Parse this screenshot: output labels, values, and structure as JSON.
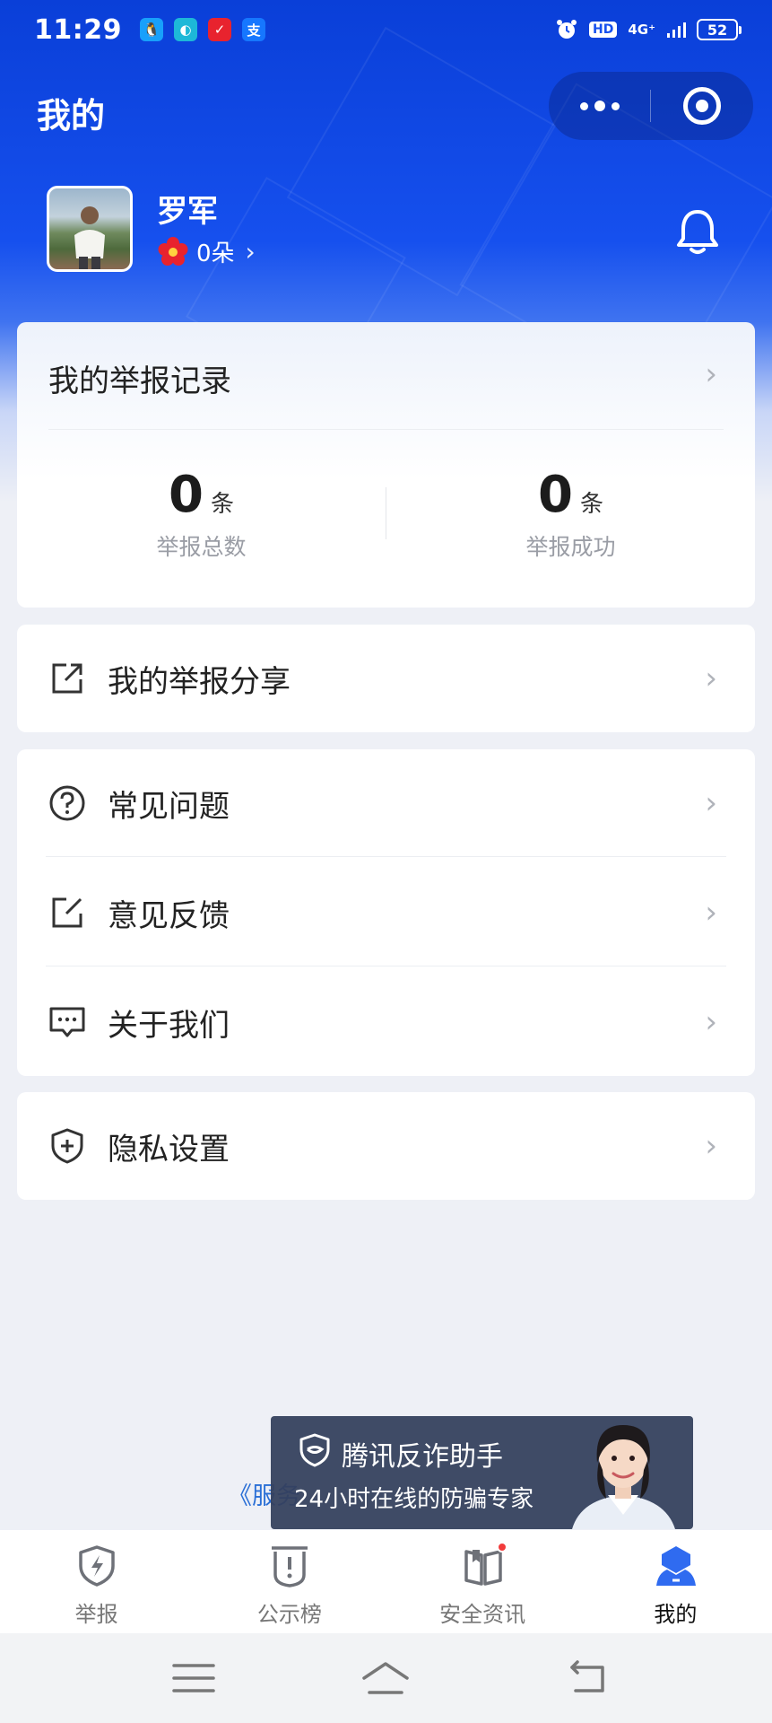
{
  "status_bar": {
    "time": "11:29",
    "network": "4G⁺",
    "hd": "HD",
    "battery": "52",
    "apps": [
      {
        "icon": "qq-icon",
        "glyph": "🐧",
        "color": "#18a0fb"
      },
      {
        "icon": "browser-icon",
        "glyph": "◐",
        "color": "#1db8d8"
      },
      {
        "icon": "news-icon",
        "glyph": "✓",
        "color": "#e8232e"
      },
      {
        "icon": "alipay-icon",
        "glyph": "支",
        "color": "#1677ff"
      }
    ]
  },
  "header": {
    "title": "我的"
  },
  "profile": {
    "name": "罗军",
    "flower_count": "0朵",
    "flower_chevron": "›"
  },
  "record": {
    "title": "我的举报记录",
    "stats": [
      {
        "value": "0",
        "unit": "条",
        "label": "举报总数"
      },
      {
        "value": "0",
        "unit": "条",
        "label": "举报成功"
      }
    ]
  },
  "menu_groups": [
    {
      "items": [
        {
          "label": "我的举报分享",
          "icon": "share-icon"
        }
      ]
    },
    {
      "items": [
        {
          "label": "常见问题",
          "icon": "question-icon"
        },
        {
          "label": "意见反馈",
          "icon": "feedback-icon"
        },
        {
          "label": "关于我们",
          "icon": "about-icon"
        }
      ]
    },
    {
      "items": [
        {
          "label": "隐私设置",
          "icon": "privacy-shield-icon"
        }
      ]
    }
  ],
  "chevron": "›",
  "service_link": "《服务",
  "assistant_tooltip": {
    "title": "腾讯反诈助手",
    "subtitle": "24小时在线的防骗专家"
  },
  "tabs": [
    {
      "label": "举报",
      "icon": "report-icon",
      "active": false
    },
    {
      "label": "公示榜",
      "icon": "notice-board-icon",
      "active": false
    },
    {
      "label": "安全资讯",
      "icon": "news-book-icon",
      "active": false,
      "badge": true
    },
    {
      "label": "我的",
      "icon": "profile-icon",
      "active": true
    }
  ],
  "colors": {
    "brand_blue": "#1650ee",
    "active_tab": "#2f6bf0",
    "flower_red": "#e8232e",
    "badge_red": "#f23b3b"
  }
}
